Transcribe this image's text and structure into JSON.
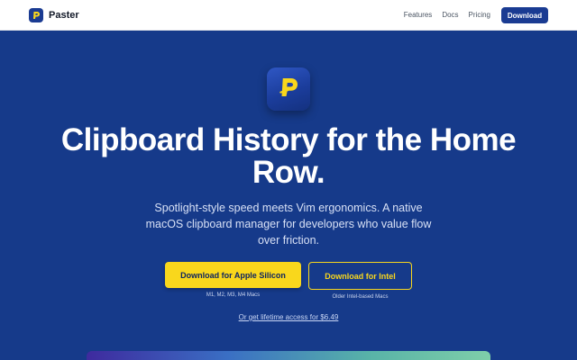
{
  "nav": {
    "brand": "Paster",
    "links": [
      "Features",
      "Docs",
      "Pricing"
    ],
    "cta": "Download"
  },
  "hero": {
    "title": "Clipboard History for the Home Row.",
    "subtitle": "Spotlight-style speed meets Vim ergonomics. A native macOS clipboard manager for developers who value flow over friction.",
    "primary_button": "Download for Apple Silicon",
    "primary_hint": "M1, M2, M3, M4 Macs",
    "secondary_button": "Download for Intel",
    "secondary_hint": "Older Intel-based Macs",
    "lifetime_link": "Or get lifetime access for $6.49"
  },
  "icons": {
    "brand_logo": "p-logo-icon",
    "app_icon": "p-logo-icon"
  },
  "colors": {
    "brand_blue": "#1a3b92",
    "hero_bg": "#163a8a",
    "accent_yellow": "#f9d71c"
  }
}
